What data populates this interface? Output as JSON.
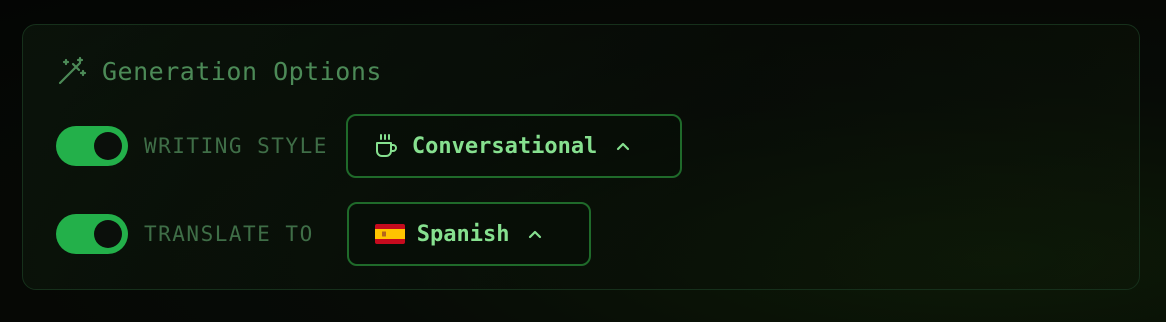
{
  "panel": {
    "title": "Generation Options",
    "title_icon": "magic-wand-icon"
  },
  "options": [
    {
      "enabled": true,
      "label": "WRITING STYLE",
      "selected": "Conversational",
      "icon": "coffee-cup-icon"
    },
    {
      "enabled": true,
      "label": "TRANSLATE TO",
      "selected": "Spanish",
      "icon": "spain-flag-icon"
    }
  ],
  "colors": {
    "accent": "#23b04a",
    "value_text": "#86e08f",
    "label_text": "#3f6e47",
    "border": "#1f6a2a"
  }
}
